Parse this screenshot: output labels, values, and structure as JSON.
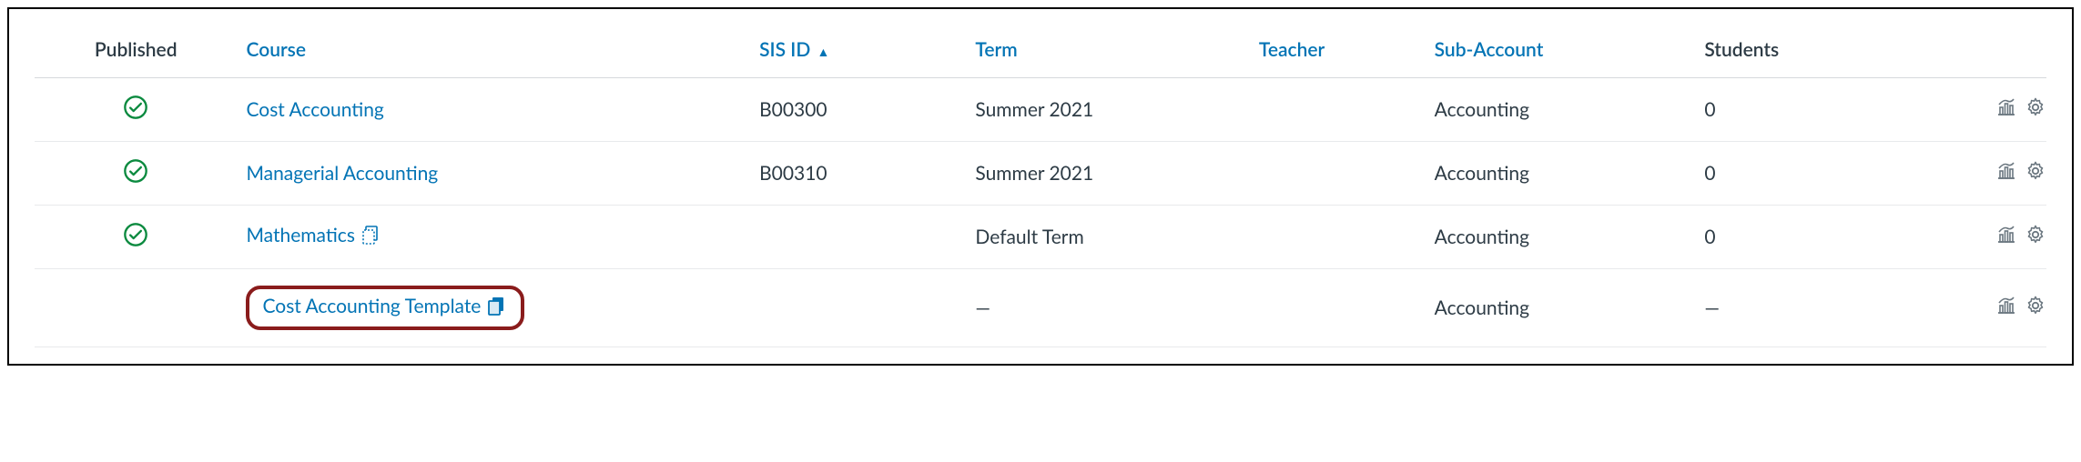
{
  "headers": {
    "published": "Published",
    "course": "Course",
    "sis": "SIS ID",
    "term": "Term",
    "teacher": "Teacher",
    "subaccount": "Sub-Account",
    "students": "Students"
  },
  "sort_indicator": "▲",
  "rows": [
    {
      "published": true,
      "course": "Cost Accounting",
      "course_icon": null,
      "sis": "B00300",
      "term": "Summer 2021",
      "teacher": "",
      "subaccount": "Accounting",
      "students": "0",
      "highlight": false
    },
    {
      "published": true,
      "course": "Managerial Accounting",
      "course_icon": null,
      "sis": "B00310",
      "term": "Summer 2021",
      "teacher": "",
      "subaccount": "Accounting",
      "students": "0",
      "highlight": false
    },
    {
      "published": true,
      "course": "Mathematics",
      "course_icon": "blueprint",
      "sis": "",
      "term": "Default Term",
      "teacher": "",
      "subaccount": "Accounting",
      "students": "0",
      "highlight": false
    },
    {
      "published": false,
      "course": "Cost Accounting Template",
      "course_icon": "template",
      "sis": "",
      "term": "—",
      "teacher": "",
      "subaccount": "Accounting",
      "students": "—",
      "highlight": true
    }
  ]
}
